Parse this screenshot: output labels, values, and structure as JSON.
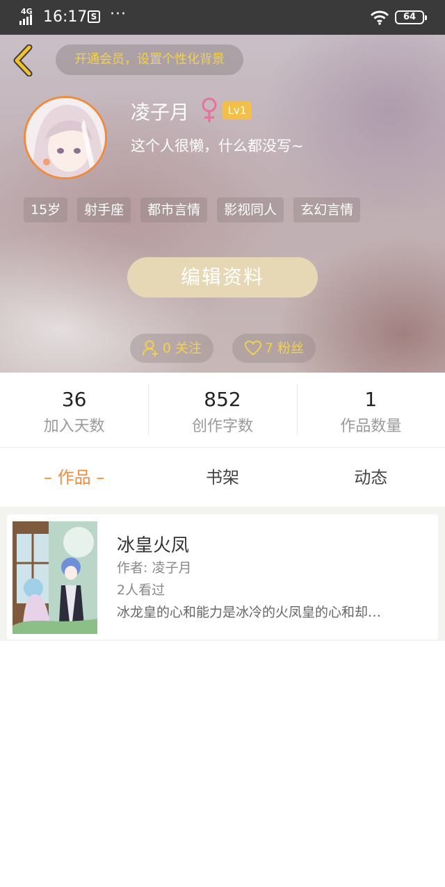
{
  "status_bar": {
    "network": "4G",
    "time": "16:17",
    "app_icon": "S",
    "more": "···",
    "battery": "64"
  },
  "header": {
    "vip_banner": "开通会员，设置个性化背景",
    "user_name": "凌子月",
    "gender_symbol": "♀",
    "level": "Lv1",
    "bio": "这个人很懒，什么都没写~",
    "tags": [
      "15岁",
      "射手座",
      "都市言情",
      "影视同人",
      "玄幻言情"
    ],
    "edit_button": "编辑资料",
    "following": "0 关注",
    "fans": "7 粉丝"
  },
  "stats": [
    {
      "value": "36",
      "label": "加入天数"
    },
    {
      "value": "852",
      "label": "创作字数"
    },
    {
      "value": "1",
      "label": "作品数量"
    }
  ],
  "tabs": [
    "– 作品 –",
    "书架",
    "动态"
  ],
  "book": {
    "title": "冰皇火凤",
    "author": "作者: 凌子月",
    "views": "2人看过",
    "description": "冰龙皇的心和能力是冰冷的火凤皇的心和却…"
  },
  "colors": {
    "accent": "#f08b3c",
    "vip_text": "#f2d14e",
    "level_badge": "#f2c04a",
    "edit_button": "#e6d8b4",
    "gender": "#e8709a"
  },
  "icons": [
    "back-chevron-icon",
    "female-icon",
    "add-user-icon",
    "heart-icon",
    "wifi-icon",
    "battery-icon",
    "signal-icon"
  ]
}
